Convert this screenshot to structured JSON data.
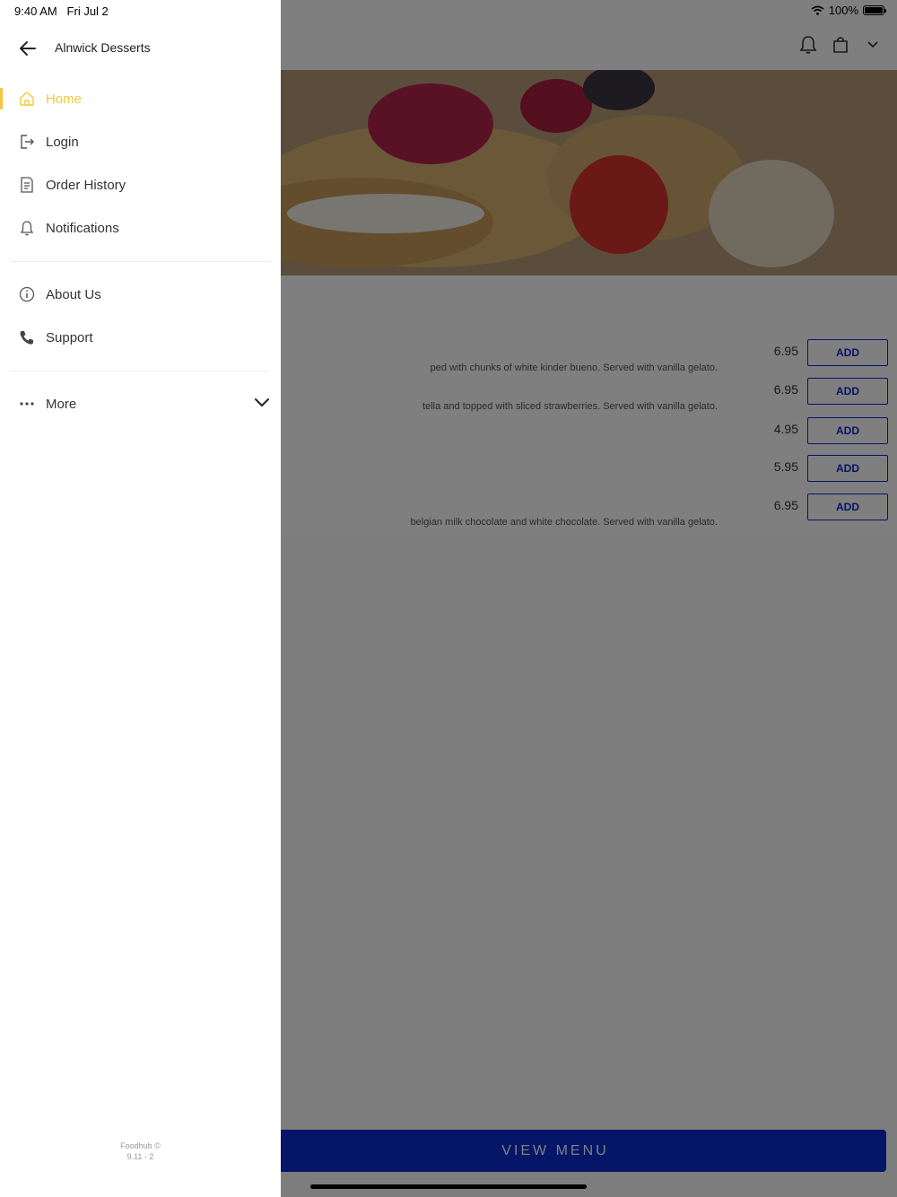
{
  "status_bar": {
    "time": "9:40 AM",
    "date": "Fri Jul 2",
    "battery": "100%",
    "battery_level": 1.0
  },
  "drawer": {
    "title": "Alnwick Desserts",
    "back_icon": "arrow-left-icon",
    "accent_color": "#f4c83a",
    "items": [
      {
        "label": "Home",
        "icon": "home-icon",
        "active": true
      },
      {
        "label": "Login",
        "icon": "login-icon",
        "active": false
      },
      {
        "label": "Order History",
        "icon": "receipt-icon",
        "active": false
      },
      {
        "label": "Notifications",
        "icon": "bell-icon",
        "active": false
      }
    ],
    "secondary_items": [
      {
        "label": "About Us",
        "icon": "info-icon"
      },
      {
        "label": "Support",
        "icon": "phone-icon"
      }
    ],
    "more": {
      "label": "More",
      "icon": "more-dots-icon",
      "chevron": "chevron-down-icon"
    },
    "footer": {
      "line1": "Foodhub ©",
      "line2": "9.11 - 2"
    }
  },
  "background_app": {
    "header_icons": [
      "bell-icon",
      "bag-icon",
      "chevron-down-icon"
    ],
    "menu_items": [
      {
        "desc": "ped with chunks of white kinder bueno. Served with vanilla gelato.",
        "price": "6.95",
        "button": "ADD"
      },
      {
        "desc": "tella and topped with sliced strawberries. Served with vanilla gelato.",
        "price": "6.95",
        "button": "ADD"
      },
      {
        "desc": "",
        "price": "4.95",
        "button": "ADD"
      },
      {
        "desc": "",
        "price": "5.95",
        "button": "ADD"
      },
      {
        "desc": "belgian milk chocolate and white chocolate. Served with vanilla gelato.",
        "price": "6.95",
        "button": "ADD"
      }
    ],
    "view_menu_label": "VIEW MENU",
    "brand_color": "#0a2bd1"
  }
}
